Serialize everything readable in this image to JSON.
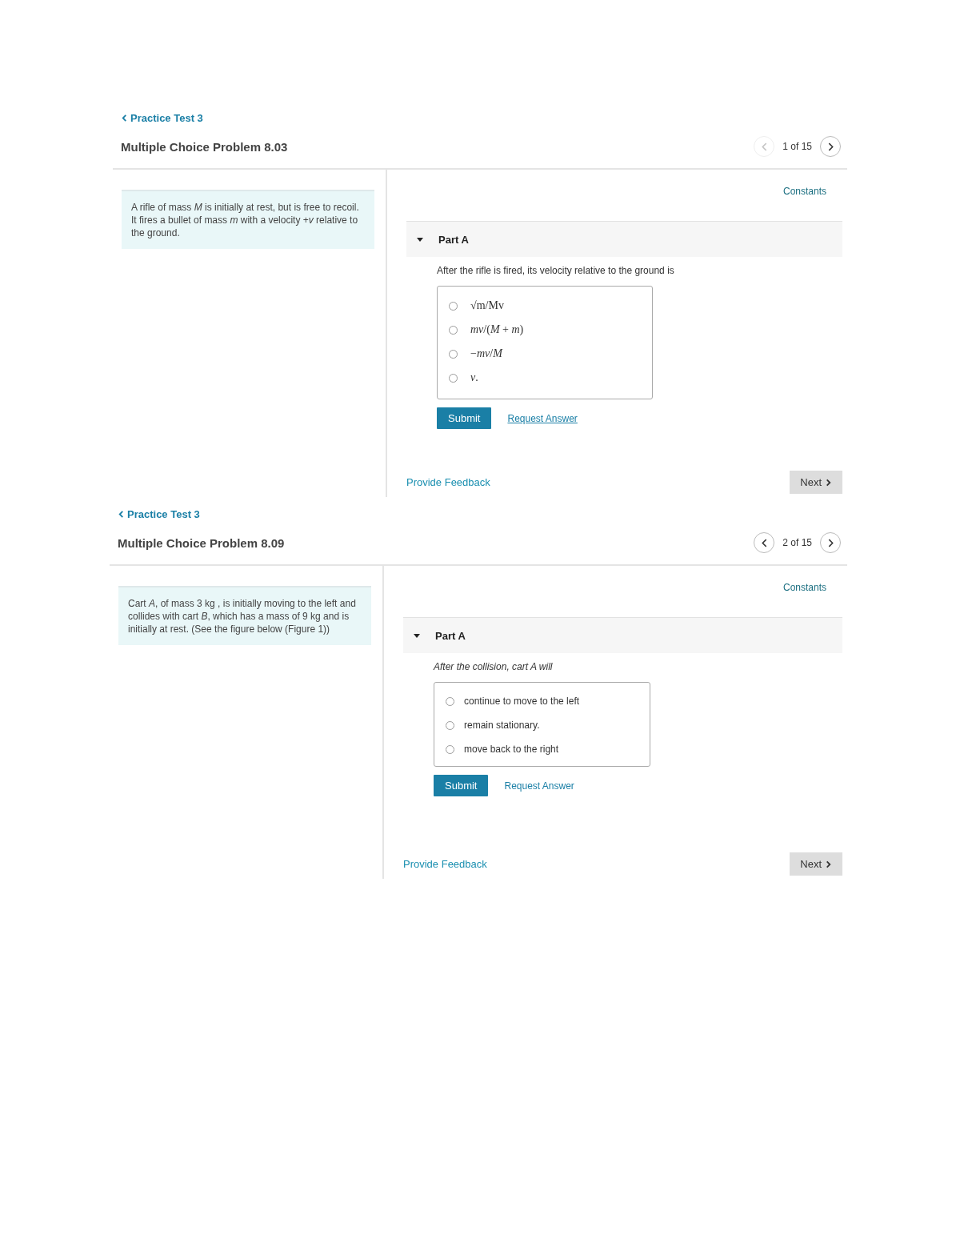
{
  "problems": [
    {
      "breadcrumb": "Practice Test 3",
      "title": "Multiple Choice Problem 8.03",
      "pager": {
        "prev_disabled": true,
        "next_disabled": false,
        "position": "1 of 15"
      },
      "statement": "A rifle of mass *M* is initially at rest, but is free to recoil. It fires a bullet of mass *m* with a velocity +*v* relative to the ground.",
      "constants": "Constants",
      "part": {
        "label": "Part A",
        "expanded": true,
        "prompt": "After the rifle is fired, its velocity relative to the ground is",
        "prompt_italic": false,
        "options": [
          {
            "text": "√m/Mv",
            "selected": false
          },
          {
            "text": "*mv*/(*M* + *m*)",
            "selected": false
          },
          {
            "text": "−*mv*/*M*",
            "selected": false
          },
          {
            "text": "*v*.",
            "selected": false
          }
        ],
        "submit": "Submit",
        "request": "Request Answer"
      },
      "feedback": "Provide Feedback",
      "next": "Next"
    },
    {
      "breadcrumb": "Practice Test 3",
      "title": "Multiple Choice Problem 8.09",
      "pager": {
        "prev_disabled": false,
        "next_disabled": false,
        "position": "2 of 15"
      },
      "statement": "Cart *A*, of mass 3 kg , is initially moving to the left and collides with cart *B*, which has a mass of 9 kg and is initially at rest. (See the figure below (Figure 1))",
      "constants": "Constants",
      "part": {
        "label": "Part A",
        "expanded": true,
        "prompt": "After the collision, cart A will",
        "prompt_italic": true,
        "options": [
          {
            "text": "continue to move to the left",
            "selected": false
          },
          {
            "text": "remain stationary.",
            "selected": false
          },
          {
            "text": "move back to the right",
            "selected": false
          }
        ],
        "submit": "Submit",
        "request": "Request Answer"
      },
      "feedback": "Provide Feedback",
      "next": "Next"
    }
  ]
}
